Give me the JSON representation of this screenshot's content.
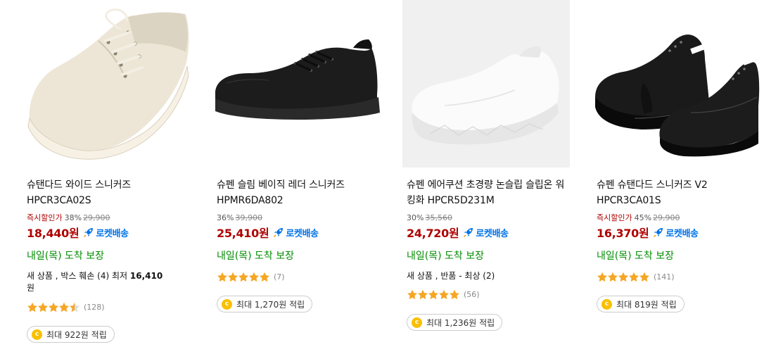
{
  "colors": {
    "price": "#ae0000",
    "rocket": "#0073e9",
    "arrival": "#008c00",
    "star": "#f5a623",
    "coin": "#f8c000"
  },
  "products": [
    {
      "name": "슈탠다드 와이드 스니커즈 HPCR3CA02S",
      "instant_label": "즉시할인가",
      "discount": "38%",
      "original_price": "29,900",
      "price": "18,440원",
      "rocket_label": "로켓배송",
      "arrival": "내일(목) 도착 보장",
      "other_seller": {
        "prefix": "새 상품 , 박스 훼손 (4) 최저 ",
        "price": "16,410",
        "suffix": "원"
      },
      "rating": 4.5,
      "review_count": "(128)",
      "reward": "최대 922원 적립"
    },
    {
      "name": "슈펜 슬림 베이직 레더 스니커즈 HPMR6DA802",
      "instant_label": "",
      "discount": "36%",
      "original_price": "39,900",
      "price": "25,410원",
      "rocket_label": "로켓배송",
      "arrival": "내일(목) 도착 보장",
      "rating": 5,
      "review_count": "(7)",
      "reward": "최대 1,270원 적립"
    },
    {
      "name": "슈펜 에어쿠션 초경량 논슬립 슬립온 워킹화 HPCR5D231M",
      "instant_label": "",
      "discount": "30%",
      "original_price": "35,560",
      "price": "24,720원",
      "rocket_label": "로켓배송",
      "arrival": "내일(목) 도착 보장",
      "other_seller": {
        "prefix": "새 상품 , 반품 - 최상 (2)",
        "price": "",
        "suffix": ""
      },
      "rating": 5,
      "review_count": "(56)",
      "reward": "최대 1,236원 적립"
    },
    {
      "name": "슈펜 슈탠다드 스니커즈 V2 HPCR3CA01S",
      "instant_label": "즉시할인가",
      "discount": "45%",
      "original_price": "29,900",
      "price": "16,370원",
      "rocket_label": "로켓배송",
      "arrival": "내일(목) 도착 보장",
      "rating": 5,
      "review_count": "(141)",
      "reward": "최대 819원 적립"
    }
  ]
}
